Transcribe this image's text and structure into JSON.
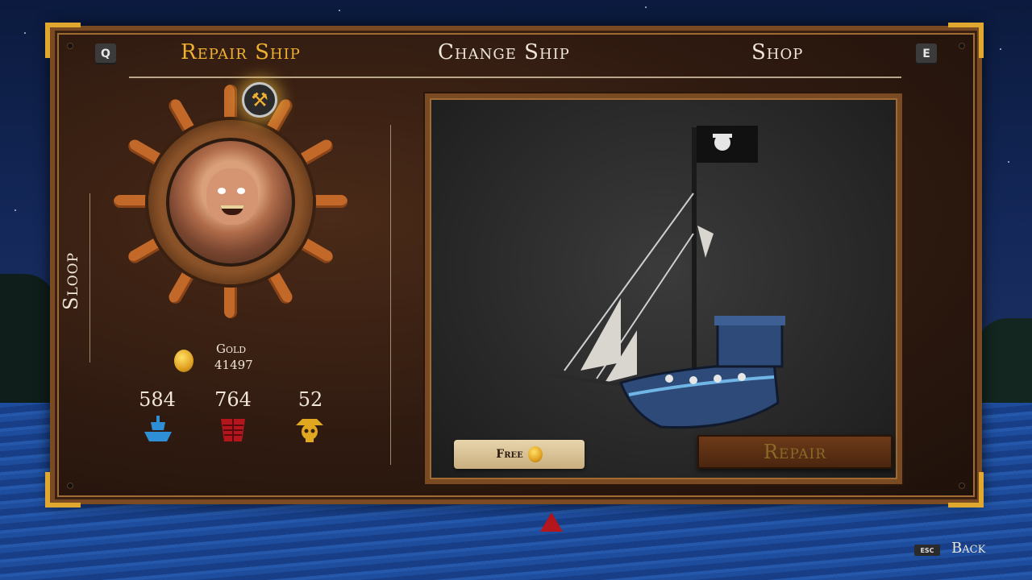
{
  "tabs": [
    {
      "key": "Q",
      "label": "Repair Ship",
      "active": true
    },
    {
      "label": "Change Ship",
      "active": false
    },
    {
      "label": "Shop",
      "active": false,
      "key": "E"
    }
  ],
  "ship": {
    "class_name": "Sloop"
  },
  "gold": {
    "label": "Gold",
    "value": "41497"
  },
  "stats": [
    {
      "value": "584",
      "icon": "hull-icon",
      "color": "#2e8fd6"
    },
    {
      "value": "764",
      "icon": "armor-icon",
      "color": "#b3161c"
    },
    {
      "value": "52",
      "icon": "crew-skull-icon",
      "color": "#e0a820"
    }
  ],
  "repair": {
    "price_label": "Free",
    "button_label": "Repair"
  },
  "footer": {
    "back_key": "ESC",
    "back_label": "Back"
  },
  "colors": {
    "accent": "#f0b030",
    "panel": "#2f1a10",
    "frame": "#7a4a22"
  }
}
